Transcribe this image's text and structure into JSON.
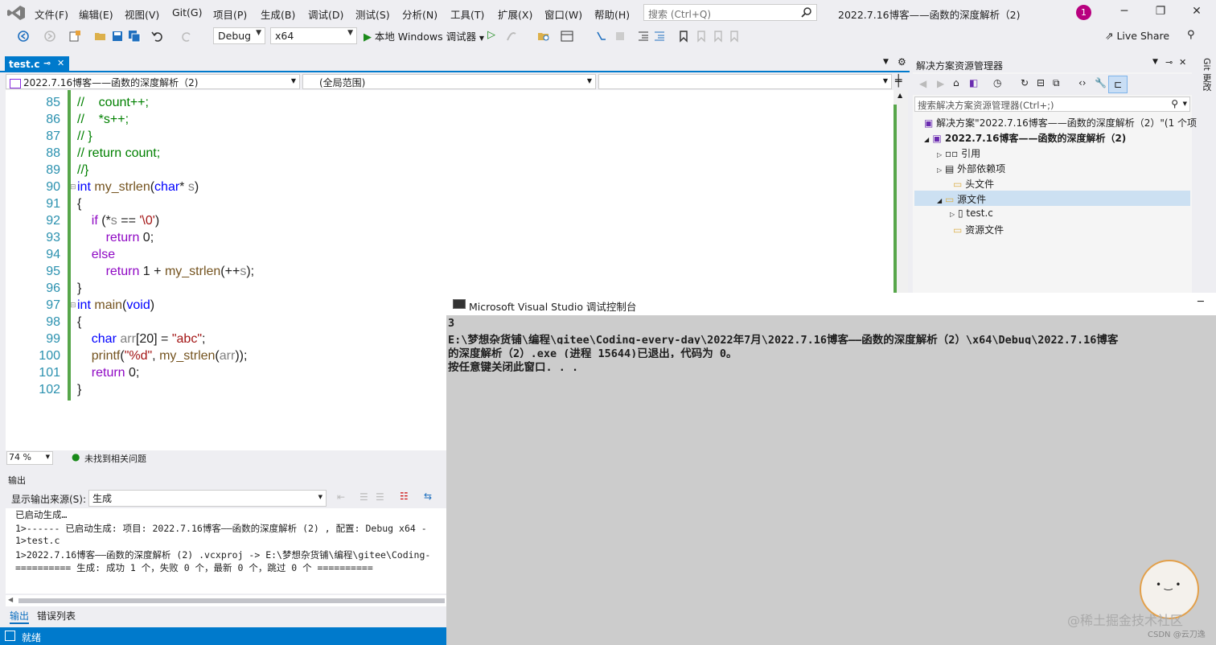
{
  "menubar": {
    "items": [
      "文件(F)",
      "编辑(E)",
      "视图(V)",
      "Git(G)",
      "项目(P)",
      "生成(B)",
      "调试(D)",
      "测试(S)",
      "分析(N)",
      "工具(T)",
      "扩展(X)",
      "窗口(W)",
      "帮助(H)"
    ],
    "search_placeholder": "搜索 (Ctrl+Q)",
    "window_title": "2022.7.16博客——函数的深度解析（2)",
    "notification_count": "1",
    "live_share": "Live Share"
  },
  "toolbar": {
    "config": "Debug",
    "platform": "x64",
    "run_label": "本地 Windows 调试器"
  },
  "doc_tabs": {
    "active": "test.c"
  },
  "navbar": {
    "project": "2022.7.16博客——函数的深度解析（2)",
    "scope": "(全局范围)",
    "member": ""
  },
  "editor": {
    "zoom": "74 %",
    "issues": "未找到相关问题",
    "lines": [
      {
        "n": "85",
        "t": "//    count++;"
      },
      {
        "n": "86",
        "t": "//    *s++;"
      },
      {
        "n": "87",
        "t": "// }"
      },
      {
        "n": "88",
        "t": "// return count;"
      },
      {
        "n": "89",
        "t": "//}"
      },
      {
        "n": "90",
        "t": "int my_strlen(char* s)"
      },
      {
        "n": "91",
        "t": "{"
      },
      {
        "n": "92",
        "t": "    if (*s == '\\0')"
      },
      {
        "n": "93",
        "t": "        return 0;"
      },
      {
        "n": "94",
        "t": "    else"
      },
      {
        "n": "95",
        "t": "        return 1 + my_strlen(++s);"
      },
      {
        "n": "96",
        "t": "}"
      },
      {
        "n": "97",
        "t": "int main(void)"
      },
      {
        "n": "98",
        "t": "{"
      },
      {
        "n": "99",
        "t": "    char arr[20] = \"abc\";"
      },
      {
        "n": "100",
        "t": "    printf(\"%d\", my_strlen(arr));"
      },
      {
        "n": "101",
        "t": "    return 0;"
      },
      {
        "n": "102",
        "t": "}"
      }
    ]
  },
  "output": {
    "title": "输出",
    "source_label": "显示输出来源(S):",
    "source_value": "生成",
    "lines": [
      "已启动生成…",
      "1>------ 已启动生成: 项目: 2022.7.16博客——函数的深度解析 (2) , 配置: Debug x64 -",
      "1>test.c",
      "1>2022.7.16博客——函数的深度解析 (2) .vcxproj -> E:\\梦想杂货铺\\编程\\gitee\\Coding-",
      "========== 生成: 成功 1 个，失败 0 个，最新 0 个，跳过 0 个 =========="
    ],
    "tabs": [
      "输出",
      "错误列表"
    ]
  },
  "statusbar": {
    "text": "就绪"
  },
  "solution_explorer": {
    "title": "解决方案资源管理器",
    "search_placeholder": "搜索解决方案资源管理器(Ctrl+;)",
    "solution": "解决方案\"2022.7.16博客——函数的深度解析（2）\"(1 个项",
    "project": "2022.7.16博客——函数的深度解析（2)",
    "items": [
      "引用",
      "外部依赖项",
      "头文件",
      "源文件",
      "test.c",
      "资源文件"
    ],
    "side_tab": "Git 更改"
  },
  "console": {
    "title": "Microsoft Visual Studio 调试控制台",
    "lines": [
      "3",
      "E:\\梦想杂货铺\\编程\\gitee\\Coding-every-day\\2022年7月\\2022.7.16博客——函数的深度解析（2）\\x64\\Debug\\2022.7.16博客",
      "的深度解析（2）.exe (进程 15644)已退出，代码为 0。",
      "按任意键关闭此窗口. . ."
    ]
  },
  "watermark": {
    "text": "@稀土掘金技术社区",
    "sub": "CSDN @云刀逸"
  }
}
